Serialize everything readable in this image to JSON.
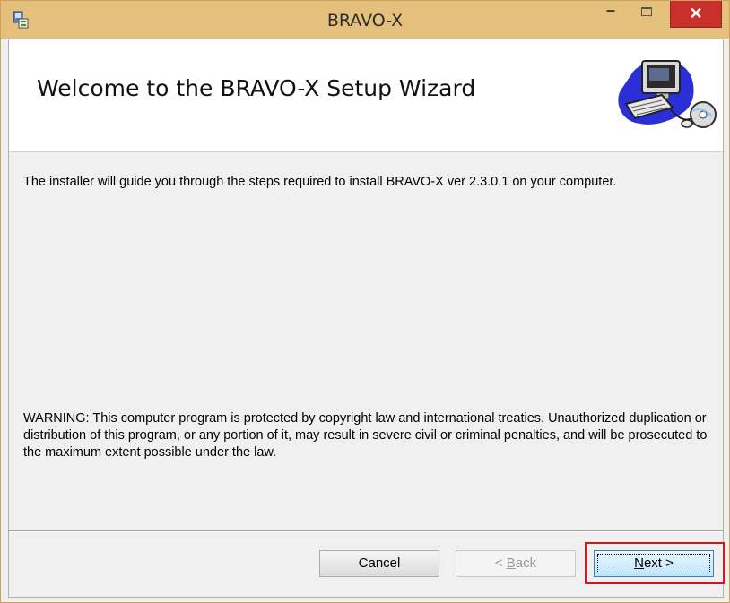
{
  "window": {
    "title": "BRAVO-X",
    "minimize_glyph": "–",
    "close_glyph": "✕"
  },
  "banner": {
    "title": "Welcome to the BRAVO-X Setup Wizard",
    "graphic_icon": "computer-setup-icon"
  },
  "body": {
    "intro": "The installer will guide you through the steps required to install BRAVO-X ver 2.3.0.1 on your computer.",
    "warning": "WARNING: This computer program is protected by copyright law and international treaties. Unauthorized duplication or distribution of this program, or any portion of it, may result in severe civil or criminal penalties, and will be prosecuted to the maximum extent possible under the law."
  },
  "buttons": {
    "cancel": "Cancel",
    "back_prefix": "< ",
    "back_mnemonic": "B",
    "back_rest": "ack",
    "next_mnemonic": "N",
    "next_rest": "ext >"
  },
  "colors": {
    "titlebar": "#e5c07c",
    "close": "#c7302b",
    "highlight": "#d4171c"
  }
}
